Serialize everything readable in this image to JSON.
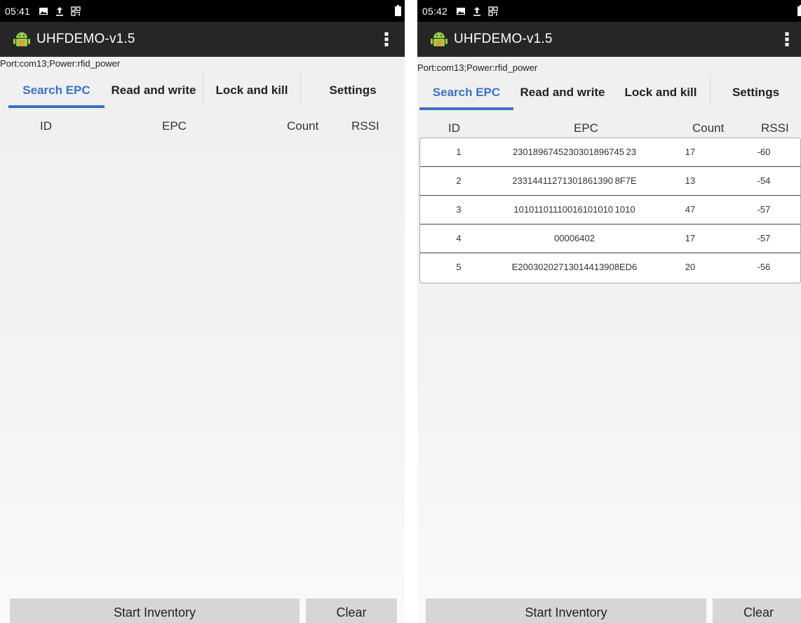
{
  "screens": [
    {
      "status": {
        "time": "05:41"
      },
      "app": {
        "title": "UHFDEMO-v1.5"
      },
      "port_line": "Port:com13;Power:rfid_power",
      "tabs": [
        {
          "label": "Search EPC",
          "active": true
        },
        {
          "label": "Read and write",
          "active": false
        },
        {
          "label": "Lock and kill",
          "active": false
        },
        {
          "label": "Settings",
          "active": false
        }
      ],
      "columns": {
        "id": "ID",
        "epc": "EPC",
        "count": "Count",
        "rssi": "RSSI"
      },
      "rows": [],
      "buttons": {
        "start": "Start Inventory",
        "clear": "Clear"
      }
    },
    {
      "status": {
        "time": "05:42"
      },
      "app": {
        "title": "UHFDEMO-v1.5"
      },
      "port_line": "Port:com13;Power:rfid_power",
      "tabs": [
        {
          "label": "Search EPC",
          "active": true
        },
        {
          "label": "Read and write",
          "active": false
        },
        {
          "label": "Lock and kill",
          "active": false
        },
        {
          "label": "Settings",
          "active": false
        }
      ],
      "columns": {
        "id": "ID",
        "epc": "EPC",
        "count": "Count",
        "rssi": "RSSI"
      },
      "rows": [
        {
          "id": "1",
          "epc": "2301896745230301896745 23",
          "count": "17",
          "rssi": "-60"
        },
        {
          "id": "2",
          "epc": "23314411271301861390 8F7E",
          "count": "13",
          "rssi": "-54"
        },
        {
          "id": "3",
          "epc": "10101101110016101010 1010",
          "count": "47",
          "rssi": "-57"
        },
        {
          "id": "4",
          "epc": "00006402",
          "count": "17",
          "rssi": "-57"
        },
        {
          "id": "5",
          "epc": "E20030202713014413908ED6",
          "count": "20",
          "rssi": "-56"
        }
      ],
      "buttons": {
        "start": "Start Inventory",
        "clear": "Clear"
      }
    }
  ],
  "icons": [
    "image-icon",
    "upload-icon",
    "qr-icon",
    "battery-icon",
    "android-app-icon",
    "overflow-menu-icon"
  ],
  "colors": {
    "accent": "#3a72c0",
    "app_bar": "#262626",
    "status_bar": "#000000",
    "button": "#d6d6d6"
  }
}
